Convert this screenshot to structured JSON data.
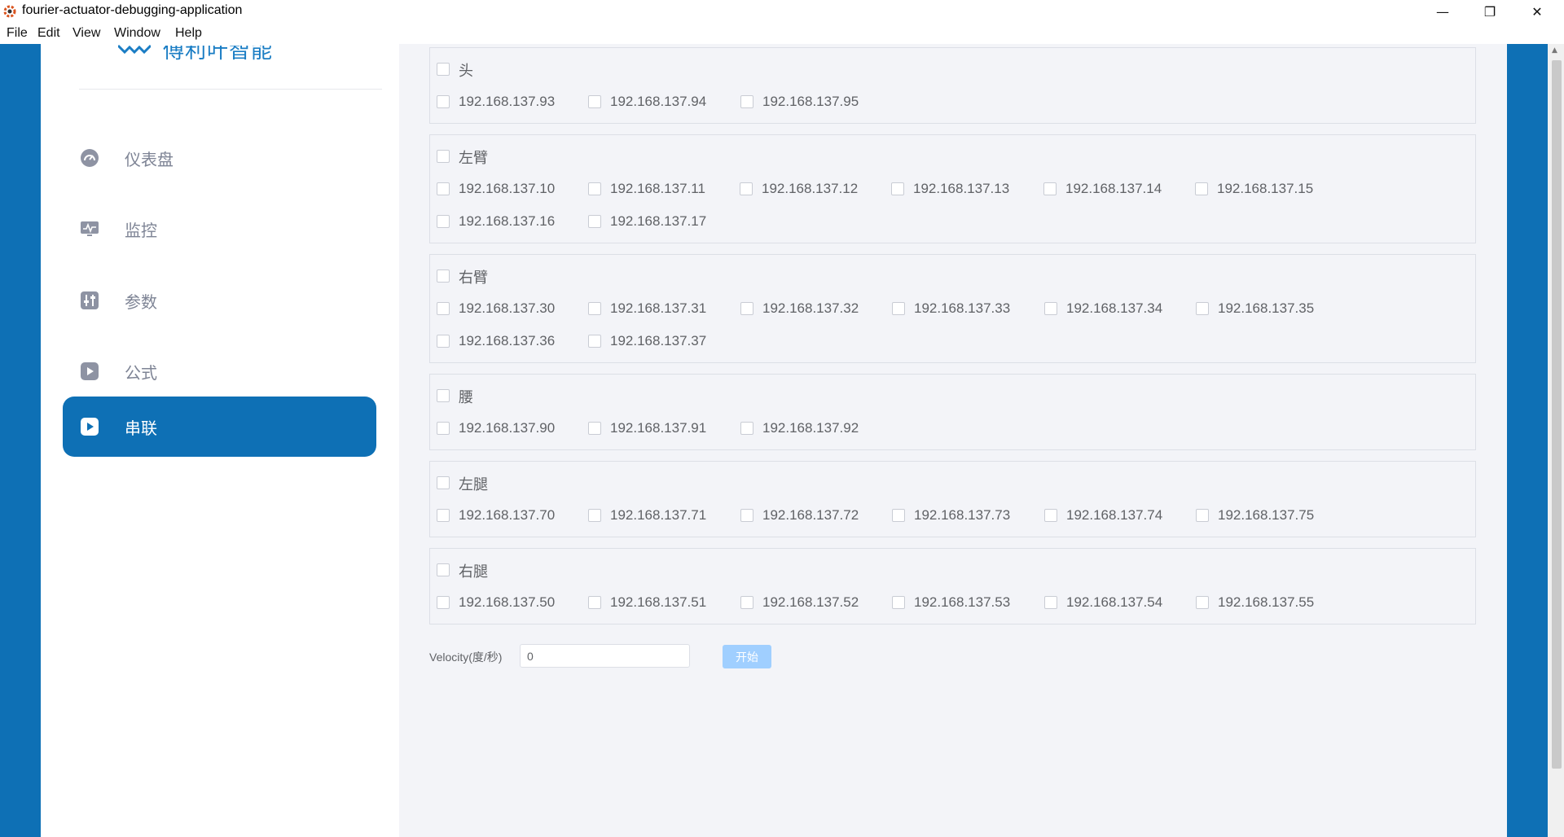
{
  "window": {
    "title": "fourier-actuator-debugging-application",
    "minimize": "—",
    "restore": "❐",
    "close": "✕"
  },
  "menu": [
    "File",
    "Edit",
    "View",
    "Window",
    "Help"
  ],
  "sidebar": {
    "logo_text": "傅利叶智能",
    "items": [
      {
        "label": "仪表盘",
        "icon": "gauge-icon",
        "active": false
      },
      {
        "label": "监控",
        "icon": "monitor-icon",
        "active": false
      },
      {
        "label": "参数",
        "icon": "sliders-icon",
        "active": false
      },
      {
        "label": "公式",
        "icon": "play-icon",
        "active": false
      },
      {
        "label": "串联",
        "icon": "play-icon",
        "active": true
      }
    ]
  },
  "groups": [
    {
      "title": "头",
      "ips": [
        "192.168.137.93",
        "192.168.137.94",
        "192.168.137.95"
      ]
    },
    {
      "title": "左臂",
      "ips": [
        "192.168.137.10",
        "192.168.137.11",
        "192.168.137.12",
        "192.168.137.13",
        "192.168.137.14",
        "192.168.137.15",
        "192.168.137.16",
        "192.168.137.17"
      ]
    },
    {
      "title": "右臂",
      "ips": [
        "192.168.137.30",
        "192.168.137.31",
        "192.168.137.32",
        "192.168.137.33",
        "192.168.137.34",
        "192.168.137.35",
        "192.168.137.36",
        "192.168.137.37"
      ]
    },
    {
      "title": "腰",
      "ips": [
        "192.168.137.90",
        "192.168.137.91",
        "192.168.137.92"
      ]
    },
    {
      "title": "左腿",
      "ips": [
        "192.168.137.70",
        "192.168.137.71",
        "192.168.137.72",
        "192.168.137.73",
        "192.168.137.74",
        "192.168.137.75"
      ]
    },
    {
      "title": "右腿",
      "ips": [
        "192.168.137.50",
        "192.168.137.51",
        "192.168.137.52",
        "192.168.137.53",
        "192.168.137.54",
        "192.168.137.55"
      ]
    }
  ],
  "velocity": {
    "label": "Velocity(度/秒)",
    "value": "0",
    "start_label": "开始"
  },
  "colors": {
    "brand": "#0e70b5",
    "start_button_disabled": "#a0cfff"
  }
}
